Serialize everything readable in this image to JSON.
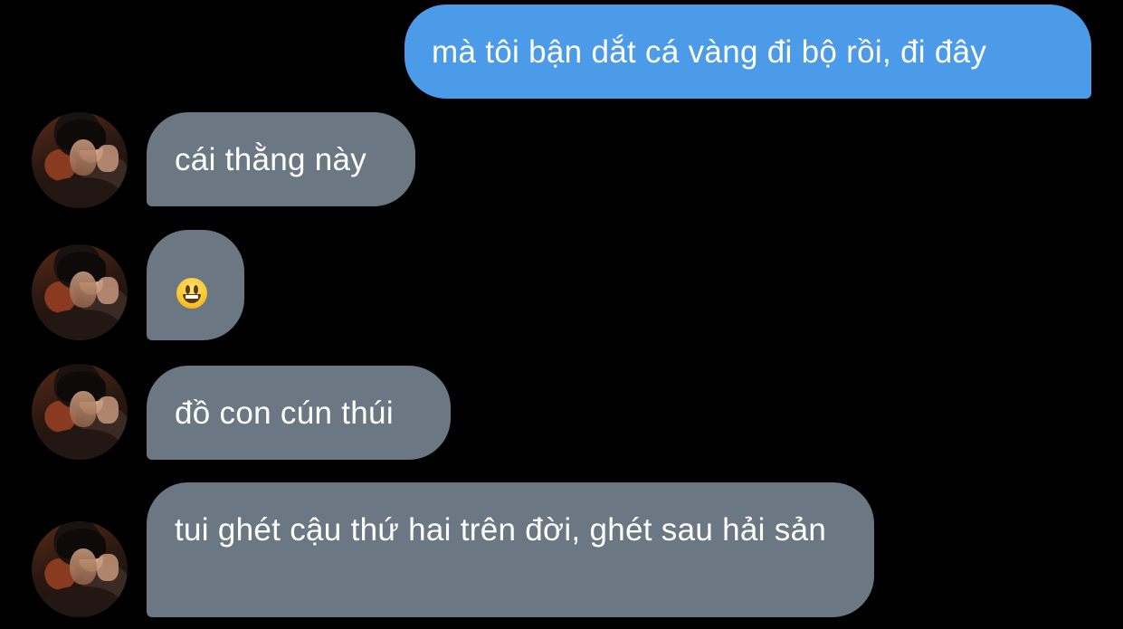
{
  "messages": [
    {
      "direction": "sent",
      "text": "mà tôi bận dắt cá vàng đi bộ rồi, đi đây"
    },
    {
      "direction": "received",
      "text": "cái thằng này"
    },
    {
      "direction": "received",
      "emoji": "smiling-face-with-open-mouth"
    },
    {
      "direction": "received",
      "text": "đồ con cún thúi"
    },
    {
      "direction": "received",
      "text": "tui ghét cậu thứ hai trên đời, ghét sau hải sản"
    }
  ],
  "colors": {
    "background": "#000000",
    "sent_bubble": "#4c9be8",
    "received_bubble": "#6b7884",
    "text": "#ffffff"
  }
}
